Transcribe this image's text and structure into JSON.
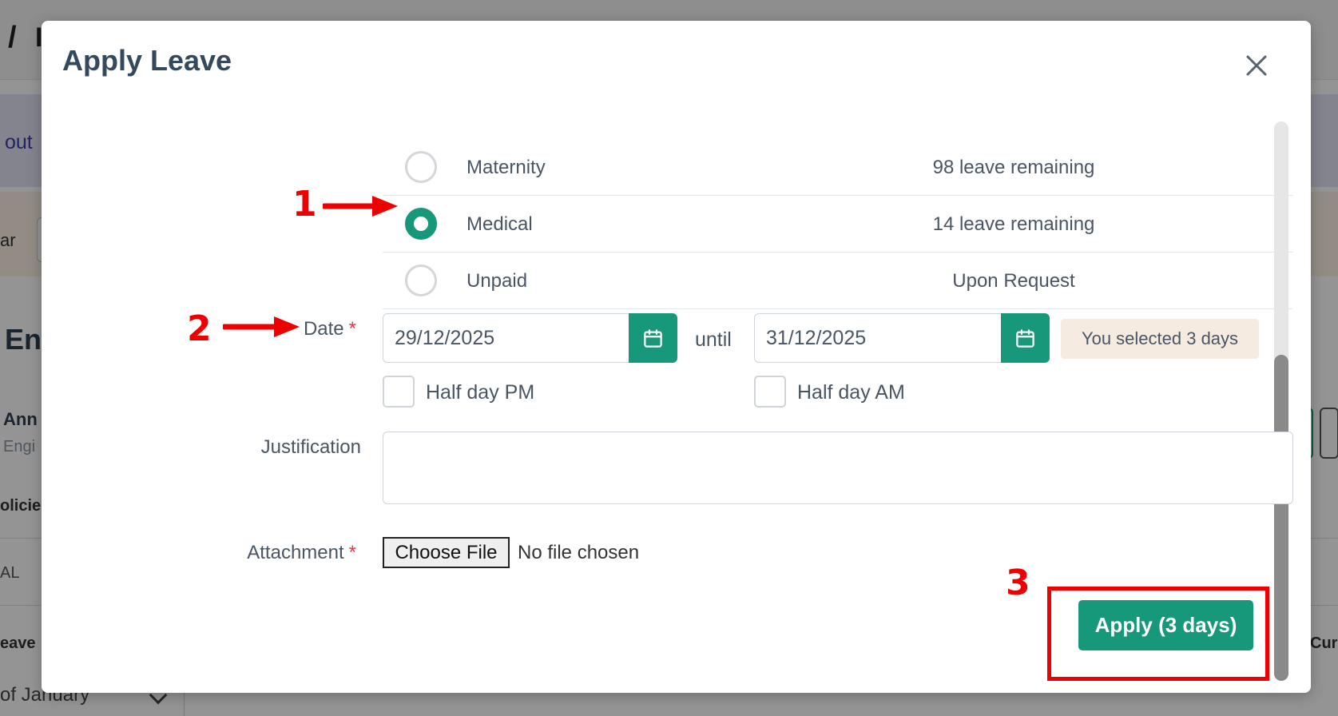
{
  "background": {
    "breadcrumb_sep": "/",
    "breadcrumb_partial": "I",
    "banner_text": "out",
    "filter_label": "ar",
    "section_title": "En",
    "employee_name": "Ann",
    "employee_role": "Engi",
    "policies_label": "olicies",
    "al_label": "AL",
    "leave_label": "eave",
    "current_label": "Cur",
    "month_select": "of January"
  },
  "modal": {
    "title": "Apply Leave",
    "leave_types": [
      {
        "label": "Maternity",
        "remaining": "98 leave remaining",
        "selected": false
      },
      {
        "label": "Medical",
        "remaining": "14 leave remaining",
        "selected": true
      },
      {
        "label": "Unpaid",
        "remaining": "Upon Request",
        "selected": false
      }
    ],
    "date": {
      "label": "Date",
      "required_mark": "*",
      "from": "29/12/2025",
      "until_label": "until",
      "to": "31/12/2025",
      "selected_summary": "You selected 3 days",
      "half_day_start": "Half day PM",
      "half_day_end": "Half day AM"
    },
    "justification": {
      "label": "Justification",
      "value": ""
    },
    "attachment": {
      "label": "Attachment",
      "required_mark": "*",
      "button": "Choose File",
      "status": "No file chosen"
    },
    "submit_label": "Apply (3 days)"
  },
  "annotations": {
    "step1": "1",
    "step2": "2",
    "step3": "3",
    "color": "#ee0000"
  },
  "colors": {
    "accent": "#17987a",
    "text": "#4a5563",
    "title": "#34495e",
    "badge_bg": "#f6ebe0"
  },
  "icons": {
    "close": "close-icon",
    "calendar": "calendar-icon"
  }
}
